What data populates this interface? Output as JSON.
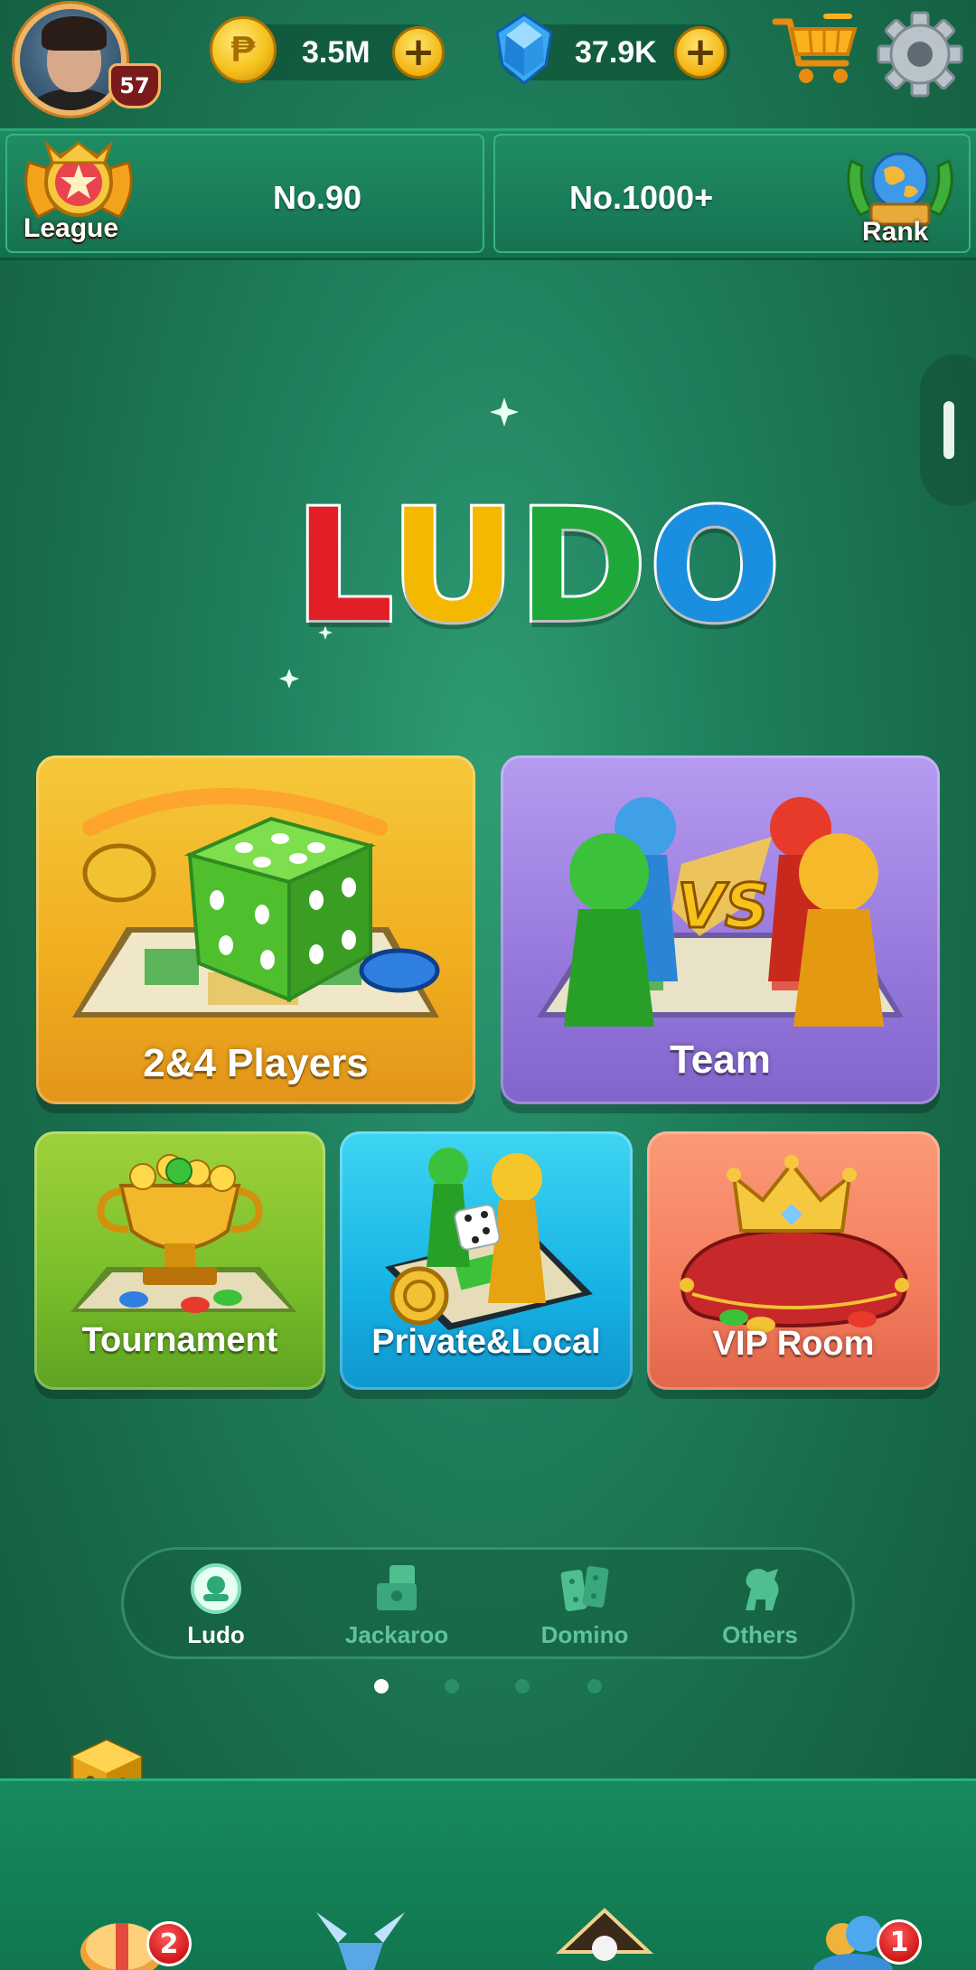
{
  "header": {
    "player_level": "57",
    "coins": "3.5M",
    "gems": "37.9K",
    "add_label": "+"
  },
  "ranks": {
    "league_label": "League",
    "league_position": "No.90",
    "world_position": "No.1000+",
    "rank_label": "Rank"
  },
  "logo": {
    "letters": [
      "L",
      "U",
      "D",
      "O"
    ],
    "colors": [
      "#e21f26",
      "#f5b800",
      "#1ea83a",
      "#1a8fe0"
    ]
  },
  "modes": {
    "players": "2&4 Players",
    "team": "Team",
    "tournament": "Tournament",
    "private_local": "Private&Local",
    "vip_room": "VIP Room",
    "vs_label": "VS"
  },
  "categories": [
    {
      "label": "Ludo",
      "active": true
    },
    {
      "label": "Jackaroo",
      "active": false
    },
    {
      "label": "Domino",
      "active": false
    },
    {
      "label": "Others",
      "active": false
    }
  ],
  "pagination": {
    "pages": 4,
    "current": 1
  },
  "bottom_nav": {
    "badge_1": "2",
    "badge_4": "1"
  },
  "colors": {
    "background": "#1f7f5c",
    "accent_gold": "#f2b311",
    "badge_red": "#d01818"
  }
}
